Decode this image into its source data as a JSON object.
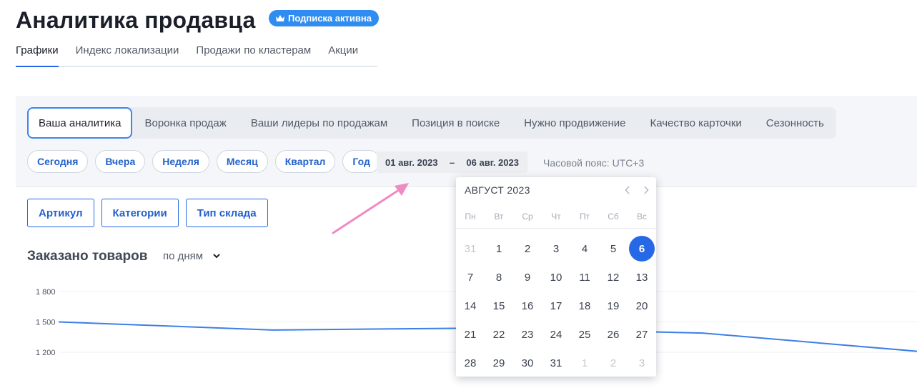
{
  "header": {
    "title": "Аналитика продавца",
    "badge": "Подписка активна"
  },
  "top_tabs": [
    {
      "label": "Графики",
      "active": true
    },
    {
      "label": "Индекс локализации"
    },
    {
      "label": "Продажи по кластерам"
    },
    {
      "label": "Акции"
    }
  ],
  "segments": [
    {
      "label": "Ваша аналитика",
      "active": true
    },
    {
      "label": "Воронка продаж"
    },
    {
      "label": "Ваши лидеры по продажам"
    },
    {
      "label": "Позиция в поиске"
    },
    {
      "label": "Нужно продвижение"
    },
    {
      "label": "Качество карточки"
    },
    {
      "label": "Сезонность"
    }
  ],
  "periods": [
    "Сегодня",
    "Вчера",
    "Неделя",
    "Месяц",
    "Квартал",
    "Год"
  ],
  "date_range": {
    "from": "01 авг. 2023",
    "sep": "–",
    "to": "06 авг. 2023"
  },
  "timezone": "Часовой пояс: UTC+3",
  "filters": [
    "Артикул",
    "Категории",
    "Тип склада"
  ],
  "chart": {
    "title": "Заказано товаров",
    "mode": "по дням"
  },
  "chart_data": {
    "type": "line",
    "title": "Заказано товаров",
    "xlabel": "",
    "ylabel": "",
    "y_ticks": [
      "1 800",
      "1 500",
      "1 200"
    ],
    "ylim": [
      1200,
      1800
    ],
    "x": [
      1,
      2,
      3,
      4,
      5
    ],
    "series": [
      {
        "values": [
          1500,
          1420,
          1440,
          1390,
          1210
        ]
      }
    ],
    "grid": true,
    "color": "#3d7fe6"
  },
  "calendar": {
    "month": "АВГУСТ 2023",
    "weekdays": [
      "Пн",
      "Вт",
      "Ср",
      "Чт",
      "Пт",
      "Сб",
      "Вс"
    ],
    "days": [
      {
        "d": "31",
        "muted": true
      },
      {
        "d": "1"
      },
      {
        "d": "2"
      },
      {
        "d": "3"
      },
      {
        "d": "4"
      },
      {
        "d": "5"
      },
      {
        "d": "6",
        "selected": true
      },
      {
        "d": "7"
      },
      {
        "d": "8"
      },
      {
        "d": "9"
      },
      {
        "d": "10"
      },
      {
        "d": "11"
      },
      {
        "d": "12"
      },
      {
        "d": "13"
      },
      {
        "d": "14"
      },
      {
        "d": "15"
      },
      {
        "d": "16"
      },
      {
        "d": "17"
      },
      {
        "d": "18"
      },
      {
        "d": "19"
      },
      {
        "d": "20"
      },
      {
        "d": "21"
      },
      {
        "d": "22"
      },
      {
        "d": "23"
      },
      {
        "d": "24"
      },
      {
        "d": "25"
      },
      {
        "d": "26"
      },
      {
        "d": "27"
      },
      {
        "d": "28"
      },
      {
        "d": "29"
      },
      {
        "d": "30"
      },
      {
        "d": "31"
      },
      {
        "d": "1",
        "muted": true
      },
      {
        "d": "2",
        "muted": true
      },
      {
        "d": "3",
        "muted": true
      }
    ]
  },
  "colors": {
    "accent": "#2668e6",
    "badge": "#2f8cf0",
    "arrow": "#f08ac4"
  }
}
